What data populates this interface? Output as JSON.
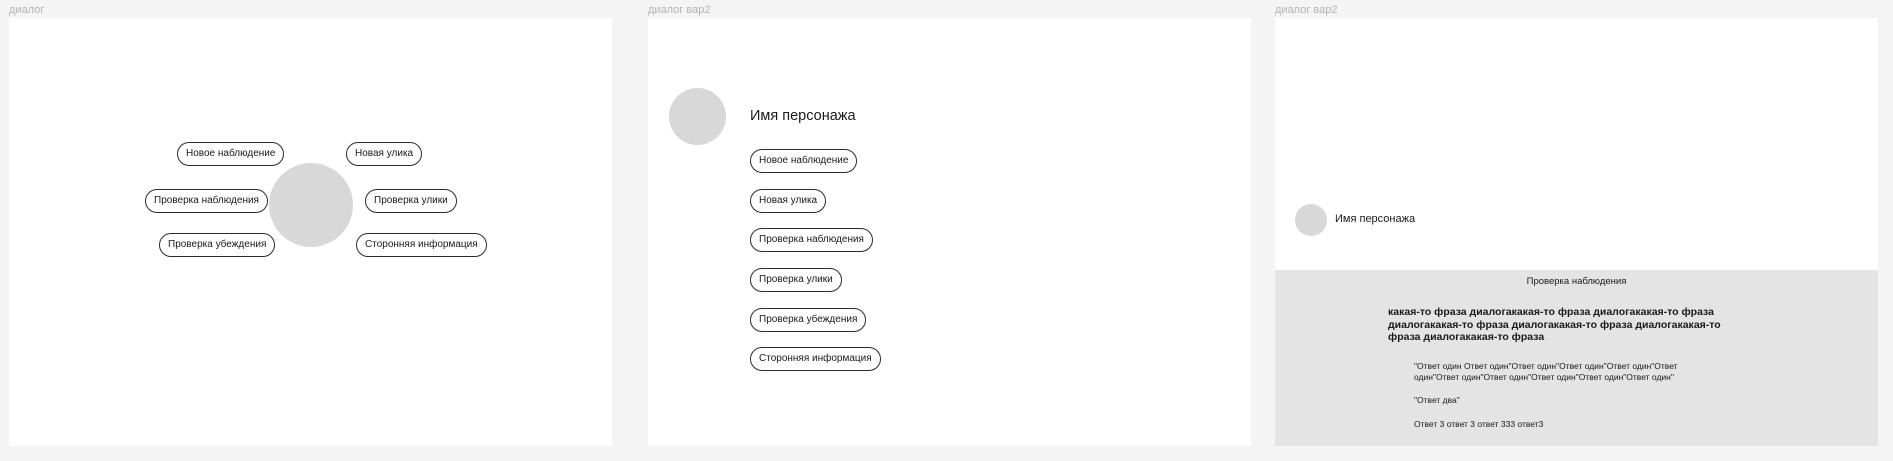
{
  "frames": [
    {
      "label": "диалог",
      "options": [
        "Новое наблюдение",
        "Новая улика",
        "Проверка наблюдения",
        "Проверка улики",
        "Проверка убеждения",
        "Сторонняя информация"
      ]
    },
    {
      "label": "диалог вар2",
      "character_name": "Имя персонажа",
      "options": [
        "Новое наблюдение",
        "Новая улика",
        "Проверка наблюдения",
        "Проверка улики",
        "Проверка убеждения",
        "Сторонняя информация"
      ]
    },
    {
      "label": "диалог вар2",
      "character_name": "Имя персонажа",
      "panel": {
        "title": "Проверка наблюдения",
        "phrase": "какая-то фраза диалогакакая-то фраза диалогакакая-то фраза диалогакакая-то фраза диалогакакая-то фраза диалогакакая-то фраза диалогакакая-то фраза",
        "answers": [
          "\"Ответ один Ответ один\"Ответ один\"Ответ один\"Ответ один\"Ответ один\"Ответ один\"Ответ один\"Ответ один\"Ответ один\"Ответ один\"",
          "\"Ответ два\"",
          "Ответ 3 ответ 3 ответ 333 ответ3"
        ]
      }
    }
  ],
  "colors": {
    "canvas": "#f4f4f4",
    "frame": "#ffffff",
    "avatar": "#d8d8d8",
    "panel": "#e4e4e4",
    "label": "#b4b4b4",
    "pill_border": "#2b2b2b"
  }
}
